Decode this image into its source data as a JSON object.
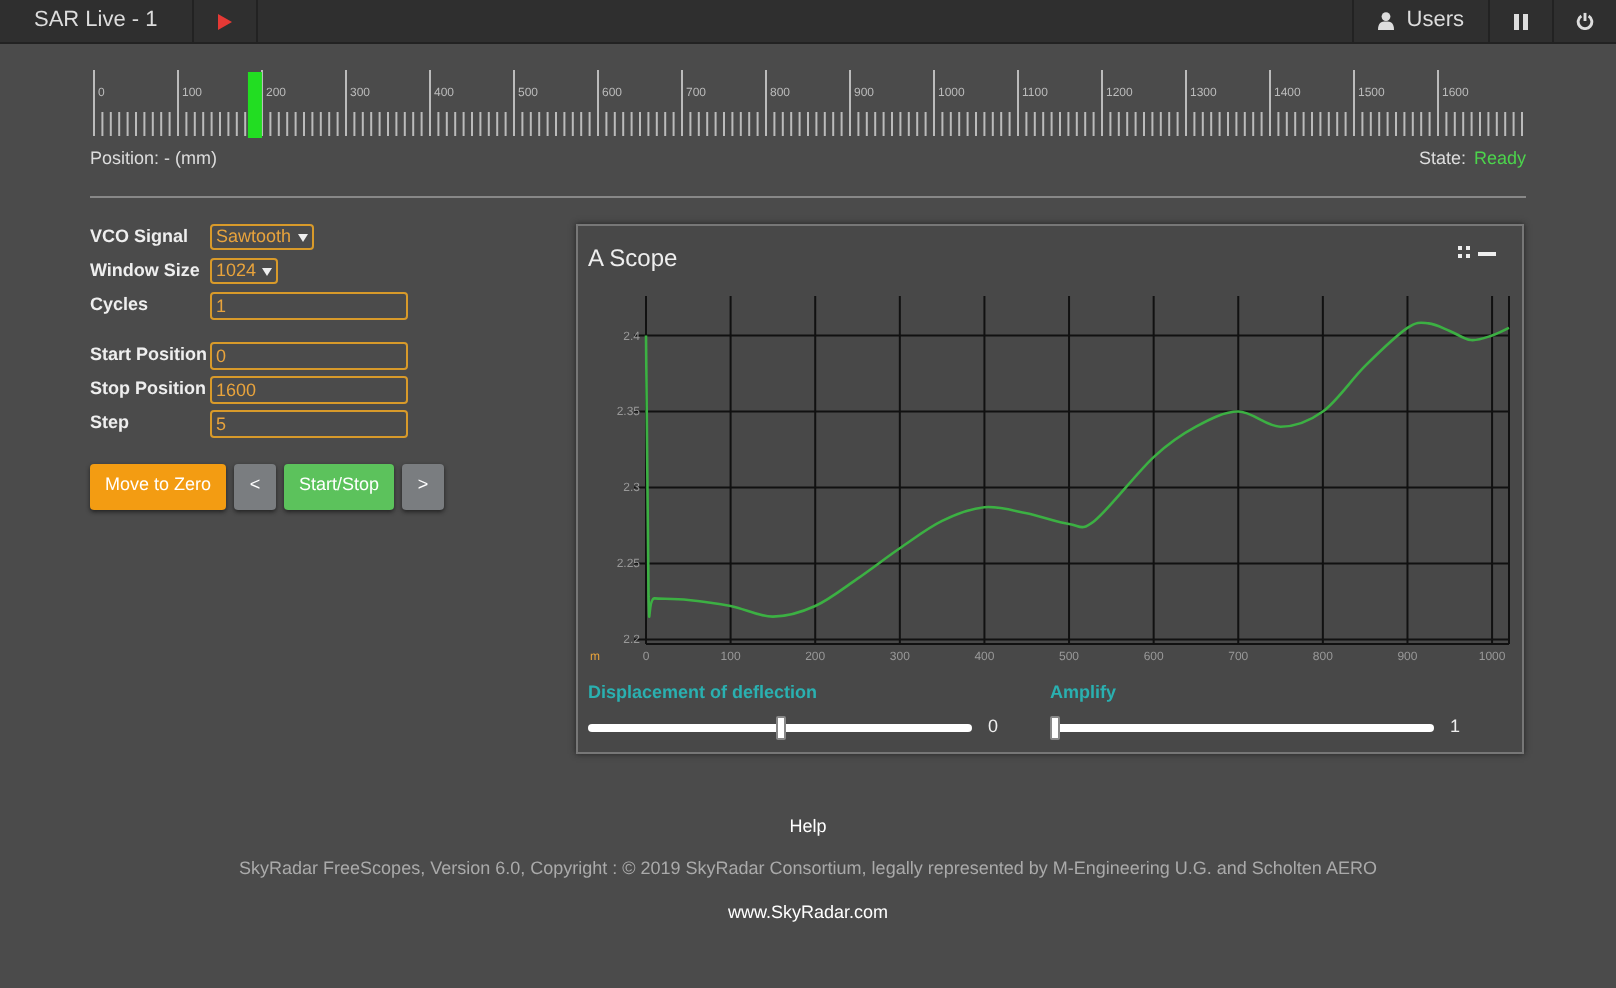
{
  "window": {
    "title": "SAR Live - 1"
  },
  "toolbar": {
    "users_label": "Users"
  },
  "ruler": {
    "labels": [
      "0",
      "100",
      "200",
      "300",
      "400",
      "500",
      "600",
      "700",
      "800",
      "900",
      "1000",
      "1100",
      "1200",
      "1300",
      "1400",
      "1500",
      "1600"
    ],
    "marker": {
      "level": 0.112
    }
  },
  "position_label": "Position: - (mm)",
  "state": {
    "label": "State:",
    "value": "Ready"
  },
  "settings": [
    {
      "label": "VCO Signal",
      "kind": "select",
      "value": "Sawtooth"
    },
    {
      "label": "Window Size",
      "kind": "select",
      "value": "1024"
    },
    {
      "label": "Cycles",
      "kind": "input",
      "value": "1"
    }
  ],
  "scan": [
    {
      "label": "Start Position",
      "kind": "input",
      "value": "0"
    },
    {
      "label": "Stop Position",
      "kind": "input",
      "value": "1600"
    },
    {
      "label": "Step",
      "kind": "input",
      "value": "5"
    }
  ],
  "buttons": [
    {
      "label": "Move to Zero",
      "kind": "primary"
    },
    {
      "label": "<",
      "kind": "nav"
    },
    {
      "label": "Start/Stop",
      "kind": "start"
    },
    {
      "label": ">",
      "kind": "nav"
    }
  ],
  "scope": {
    "title": "A Scope",
    "unit_label": "m",
    "chart_data": {
      "type": "line",
      "grid": true,
      "xlim": [
        0,
        1020
      ],
      "ylim": [
        2.197,
        2.426
      ],
      "xticks": [
        0,
        100,
        200,
        300,
        400,
        500,
        600,
        700,
        800,
        900,
        1000
      ],
      "yticks": [
        2.2,
        2.25,
        2.3,
        2.35,
        2.4
      ],
      "x": [
        0,
        3,
        10,
        50,
        100,
        150,
        200,
        250,
        300,
        350,
        400,
        450,
        500,
        530,
        600,
        650,
        700,
        750,
        800,
        850,
        900,
        925,
        950,
        975,
        1000,
        1020
      ],
      "series": [
        {
          "color": "#3cb043",
          "values": [
            2.4,
            2.228,
            2.227,
            2.226,
            2.222,
            2.215,
            2.222,
            2.24,
            2.26,
            2.278,
            2.287,
            2.283,
            2.276,
            2.278,
            2.32,
            2.34,
            2.35,
            2.34,
            2.35,
            2.38,
            2.405,
            2.408,
            2.403,
            2.397,
            2.4,
            2.405
          ]
        }
      ]
    },
    "sliders": [
      {
        "label": "Displacement of deflection",
        "level": 0.5,
        "reading": "0"
      },
      {
        "label": "Amplify",
        "level": 0,
        "reading": "1"
      }
    ]
  },
  "footer": {
    "help": "Help",
    "copyright": "SkyRadar FreeScopes, Version 6.0, Copyright : © 2019 SkyRadar Consortium, legally represented by M-Engineering U.G. and Scholten AERO",
    "link": "www.SkyRadar.com"
  }
}
